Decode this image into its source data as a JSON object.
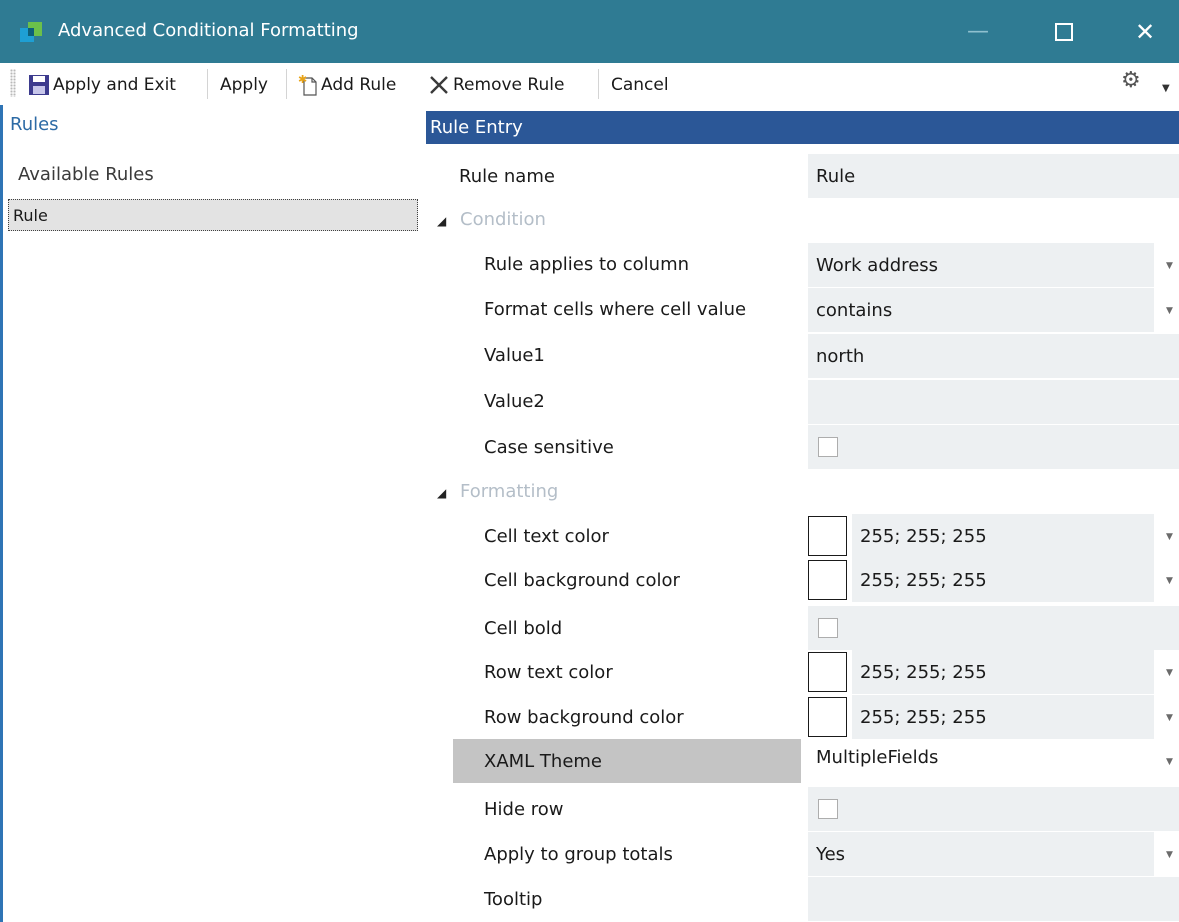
{
  "window": {
    "title": "Advanced Conditional Formatting",
    "minimize_glyph": "—",
    "close_glyph": "✕"
  },
  "toolbar": {
    "apply_and_exit": "Apply and Exit",
    "apply": "Apply",
    "add_rule": "Add Rule",
    "remove_rule": "Remove Rule",
    "cancel": "Cancel",
    "settings_icon": "gear-icon"
  },
  "left_panel": {
    "header": "Rules",
    "subheader": "Available Rules",
    "rules": [
      "Rule"
    ]
  },
  "right_panel": {
    "header": "Rule Entry",
    "rule_name_label": "Rule name",
    "rule_name_value": "Rule",
    "condition": {
      "category": "Condition",
      "applies_to_label": "Rule applies to column",
      "applies_to_value": "Work address",
      "format_where_label": "Format cells where cell value",
      "format_where_value": "contains",
      "value1_label": "Value1",
      "value1_value": "north",
      "value2_label": "Value2",
      "value2_value": "",
      "case_sensitive_label": "Case sensitive",
      "case_sensitive_checked": false
    },
    "formatting": {
      "category": "Formatting",
      "cell_text_color_label": "Cell text color",
      "cell_text_color_value": "255; 255; 255",
      "cell_bg_color_label": "Cell background color",
      "cell_bg_color_value": "255; 255; 255",
      "cell_bold_label": "Cell bold",
      "cell_bold_checked": false,
      "row_text_color_label": "Row text color",
      "row_text_color_value": "255; 255; 255",
      "row_bg_color_label": "Row background color",
      "row_bg_color_value": "255; 255; 255",
      "xaml_theme_label": "XAML Theme",
      "xaml_theme_value": "MultipleFields",
      "hide_row_label": "Hide row",
      "hide_row_checked": false,
      "group_totals_label": "Apply to group totals",
      "group_totals_value": "Yes",
      "tooltip_label": "Tooltip",
      "tooltip_value": ""
    }
  },
  "colors": {
    "titlebar": "#2f7b93",
    "section_header": "#2b5797",
    "accent_text": "#2c6aa5",
    "value_cell": "#edf0f2"
  }
}
